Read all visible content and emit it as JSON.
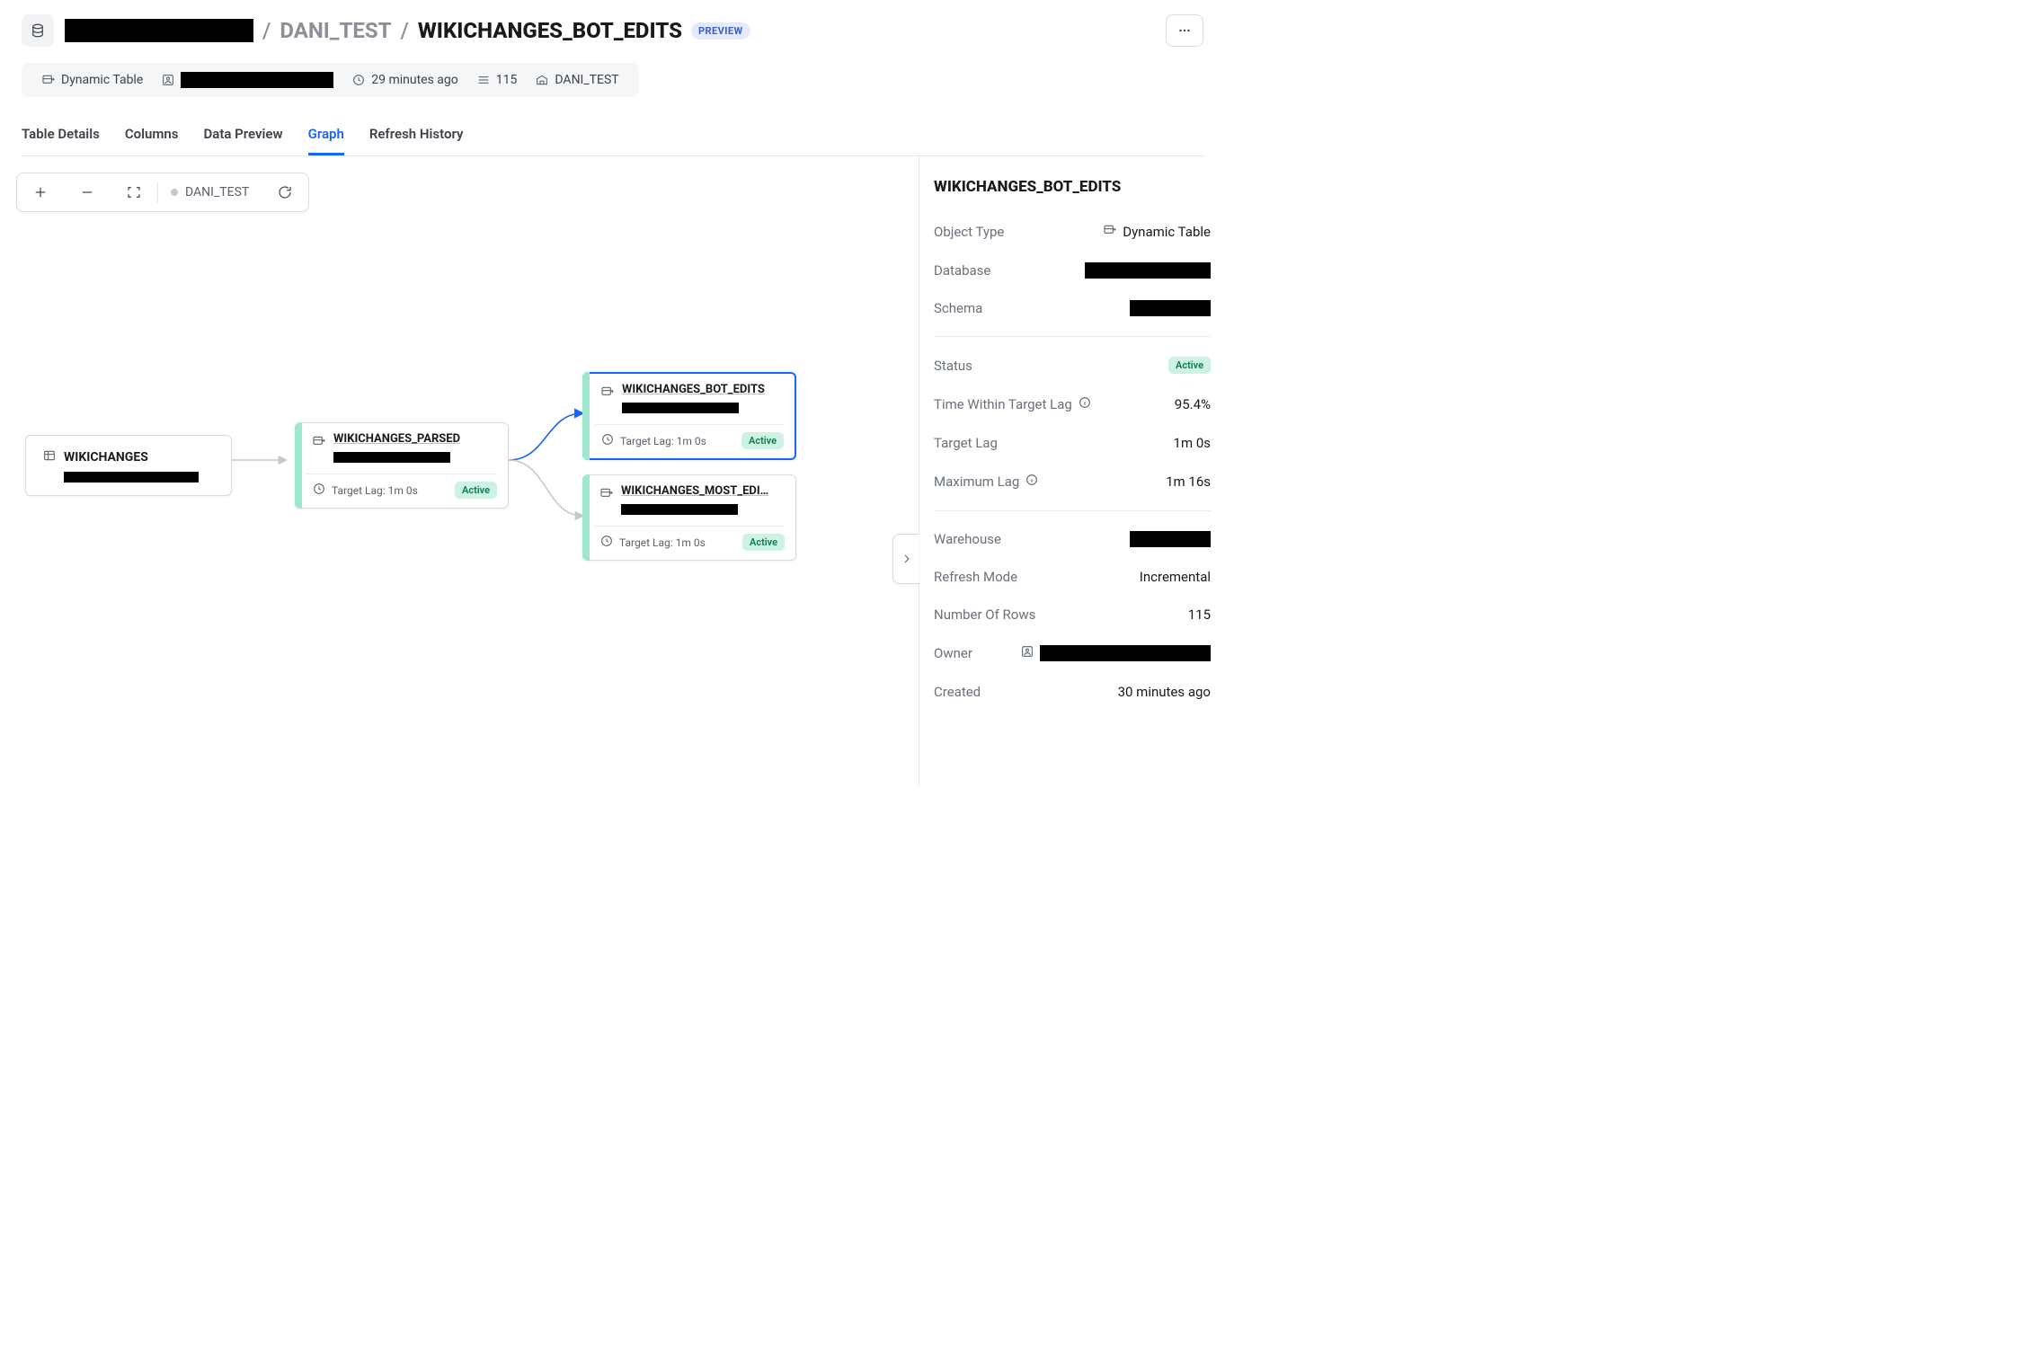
{
  "breadcrumb": {
    "schema": "DANI_TEST",
    "table": "WIKICHANGES_BOT_EDITS",
    "preview_label": "PREVIEW"
  },
  "meta": {
    "type_label": "Dynamic Table",
    "updated_label": "29 minutes ago",
    "row_count": "115",
    "warehouse_label": "DANI_TEST"
  },
  "tabs": {
    "table_details": "Table Details",
    "columns": "Columns",
    "data_preview": "Data Preview",
    "graph": "Graph",
    "refresh_history": "Refresh History"
  },
  "graph_toolbar": {
    "scope_label": "DANI_TEST"
  },
  "nodes": {
    "wikichanges": {
      "title": "WIKICHANGES"
    },
    "wikichanges_parsed": {
      "title": "WIKICHANGES_PARSED",
      "lag_label": "Target Lag: 1m 0s",
      "status": "Active"
    },
    "wikichanges_bot_edits": {
      "title": "WIKICHANGES_BOT_EDITS",
      "lag_label": "Target Lag: 1m 0s",
      "status": "Active"
    },
    "wikichanges_most_edits": {
      "title": "WIKICHANGES_MOST_EDI…",
      "lag_label": "Target Lag: 1m 0s",
      "status": "Active"
    }
  },
  "details": {
    "title": "WIKICHANGES_BOT_EDITS",
    "labels": {
      "object_type": "Object Type",
      "database": "Database",
      "schema": "Schema",
      "status": "Status",
      "time_within": "Time Within Target Lag",
      "target_lag": "Target Lag",
      "maximum_lag": "Maximum Lag",
      "warehouse": "Warehouse",
      "refresh_mode": "Refresh Mode",
      "number_of_rows": "Number Of Rows",
      "owner": "Owner",
      "created": "Created"
    },
    "values": {
      "object_type": "Dynamic Table",
      "status": "Active",
      "time_within": "95.4%",
      "target_lag": "1m 0s",
      "maximum_lag": "1m 16s",
      "refresh_mode": "Incremental",
      "number_of_rows": "115",
      "created": "30 minutes ago"
    }
  }
}
